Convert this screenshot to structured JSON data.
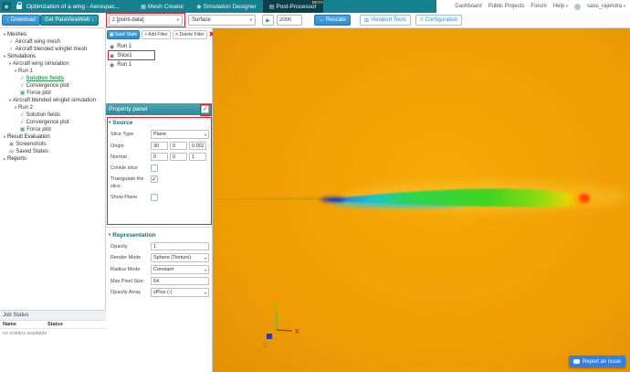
{
  "colors": {
    "header_teal": "#15818f",
    "active_tab": "#0c3f47",
    "beta_orange": "#f5a623",
    "button_blue": "#2d8fd2",
    "annotation_red": "#ec1c24",
    "viewport_orange": "#ee9d04",
    "check_green": "#2eae52"
  },
  "icons": {
    "logo": "◈",
    "mesh_tab": "▦",
    "sim_tab": "◉",
    "post_tab": "▤",
    "arrow": "▾",
    "expand_open": "▾",
    "expand_closed": "▸",
    "check": "✓",
    "plot": "▦",
    "camera": "▣",
    "save": "▤",
    "eye": "◉",
    "download": "↓",
    "play": "▶",
    "rescale": "↔",
    "viewport_tools": "⊞",
    "configuration": "≡",
    "save_state": "▣",
    "plus": "+",
    "delete": "✕",
    "red_x": "✖"
  },
  "header": {
    "title": "Optimization of a wing - Aerospac...",
    "tabs": [
      {
        "label": "Mesh Creator"
      },
      {
        "label": "Simulation Designer"
      },
      {
        "label": "Post-Processor",
        "beta": "BETA"
      }
    ],
    "nav": [
      "Dashboard",
      "Public Projects",
      "Forum",
      "Help"
    ],
    "user": "sasu_rajendra"
  },
  "toolbar": {
    "download_label": "Download",
    "paraview_label": "Get ParaViewWeb",
    "field_value": "z [point-data]",
    "surface_value": "Surface",
    "frame_value": "2000",
    "rescale_label": "Rescale",
    "viewport_tools_label": "Viewport Tools",
    "configuration_label": "Configuration"
  },
  "sidebar": {
    "items": [
      {
        "label": "Meshes"
      },
      {
        "label": "Aircraft wing mesh"
      },
      {
        "label": "Aircraft blended winglet mesh"
      },
      {
        "label": "Simulations"
      },
      {
        "label": "Aircraft wing simulation"
      },
      {
        "label": "Run 1"
      },
      {
        "label": "Solution fields"
      },
      {
        "label": "Convergence plot"
      },
      {
        "label": "Force plot"
      },
      {
        "label": "Aircraft blended winglet simulation"
      },
      {
        "label": "Run 2"
      },
      {
        "label": "Solution fields"
      },
      {
        "label": "Convergence plot"
      },
      {
        "label": "Force plot"
      },
      {
        "label": "Result Evaluation"
      },
      {
        "label": "Screenshots"
      },
      {
        "label": "Saved States"
      },
      {
        "label": "Reports"
      }
    ]
  },
  "pipeline": {
    "save_state_label": "Save State",
    "add_filter_label": "Add Filter",
    "delete_filter_label": "Delete Filter",
    "items": [
      {
        "label": "Run 1"
      },
      {
        "label": "Slice1"
      },
      {
        "label": "Run 1"
      }
    ]
  },
  "properties": {
    "panel_title": "Property panel",
    "source": {
      "title": "Source",
      "slice_type_label": "Slice Type",
      "slice_type_value": "Plane",
      "origin_label": "Origin",
      "origin": [
        "30",
        "0",
        "0.002"
      ],
      "normal_label": "Normal",
      "normal": [
        "0",
        "0",
        "1"
      ],
      "crinkle_label": "Crinkle slice",
      "triangulate_label": "Triangulate the slice",
      "show_plane_label": "Show Plane"
    },
    "representation": {
      "title": "Representation",
      "opacity_label": "Opacity",
      "opacity_value": "1",
      "render_mode_label": "Render Mode",
      "render_mode_value": "Sphere (Texture)",
      "radius_mode_label": "Radius Mode",
      "radius_mode_value": "Constant",
      "max_pixel_label": "Max Pixel Size",
      "max_pixel_value": "64",
      "opacity_array_label": "Opacity Array",
      "opacity_array_value": "vPlus (-)"
    }
  },
  "job_status": {
    "title": "Job Status",
    "columns": [
      "Name",
      "Status"
    ],
    "empty": "no entities available"
  },
  "viewport": {
    "axis": {
      "x": "X",
      "y": "Y",
      "z": "Z"
    },
    "report_issue": "Report an issue"
  }
}
